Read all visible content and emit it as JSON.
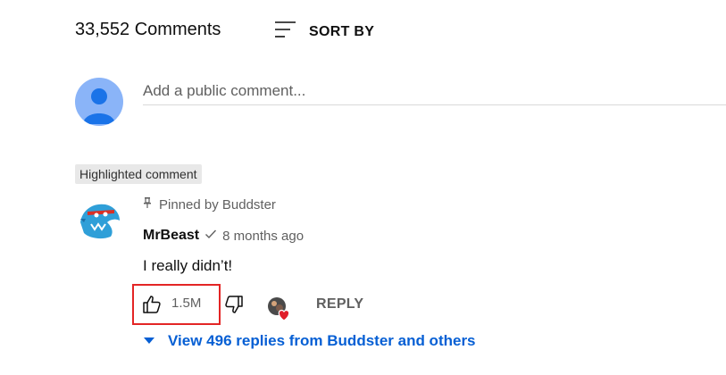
{
  "header": {
    "comment_count": "33,552 Comments",
    "sort_label": "SORT BY"
  },
  "add_comment": {
    "placeholder": "Add a public comment..."
  },
  "highlight_badge": "Highlighted comment",
  "comment": {
    "pinned_text": "Pinned by Buddster",
    "author": "MrBeast",
    "timestamp": "8 months ago",
    "text": "I really didn’t!",
    "like_count": "1.5M",
    "reply_label": "REPLY"
  },
  "replies": {
    "label": "View 496 replies from Buddster and others"
  },
  "colors": {
    "link": "#065fd4",
    "highlight_box": "#e32525",
    "avatar_user": "#8ab4f8",
    "avatar_user_figure": "#1a73e8"
  },
  "icons": {
    "sort": "sort-lines-icon",
    "pin": "pin-icon",
    "verified": "check-icon",
    "like": "thumbs-up-icon",
    "dislike": "thumbs-down-icon",
    "creator_heart": "heart-avatar-icon",
    "expand": "caret-down-icon"
  }
}
